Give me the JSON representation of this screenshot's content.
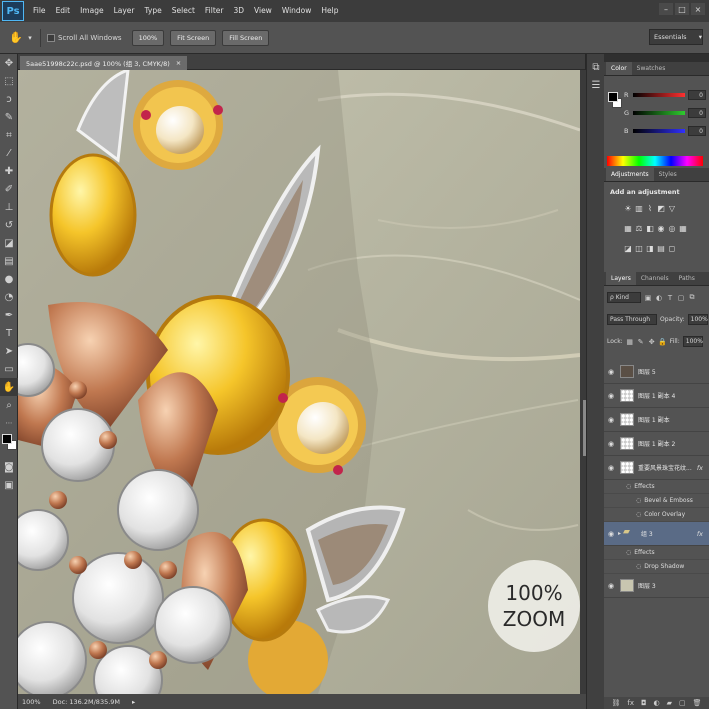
{
  "app": {
    "logo": "Ps"
  },
  "menu": [
    "File",
    "Edit",
    "Image",
    "Layer",
    "Type",
    "Select",
    "Filter",
    "3D",
    "View",
    "Window",
    "Help"
  ],
  "window_controls": [
    "–",
    "□",
    "×"
  ],
  "options_bar": {
    "scroll_all_windows": "Scroll All Windows",
    "btn_100": "100%",
    "btn_fit": "Fit Screen",
    "btn_fill": "Fill Screen",
    "workspace": "Essentials"
  },
  "document": {
    "tab_title": "5aae51998c22c.psd @ 100% (组 3, CMYK/8)",
    "zoom_badge_line1": "100%",
    "zoom_badge_line2": "ZOOM"
  },
  "status": {
    "zoom": "100%",
    "doc": "Doc: 136.2M/835.9M"
  },
  "color_panel": {
    "tabs": [
      "Color",
      "Swatches"
    ],
    "r": {
      "label": "R",
      "value": "0"
    },
    "g": {
      "label": "G",
      "value": "0"
    },
    "b": {
      "label": "B",
      "value": "0"
    },
    "colors": {
      "r": "#ff3030",
      "g": "#2ecc2e",
      "b": "#3030ff"
    }
  },
  "adjustments_panel": {
    "tabs": [
      "Adjustments",
      "Styles"
    ],
    "title": "Add an adjustment"
  },
  "layers_panel": {
    "tabs": [
      "Layers",
      "Channels",
      "Paths"
    ],
    "kind": "ρ Kind",
    "blend_mode": "Pass Through",
    "opacity_label": "Opacity:",
    "opacity_value": "100%",
    "lock_label": "Lock:",
    "fill_label": "Fill:",
    "fill_value": "100%",
    "layers": [
      {
        "name": "图层 5",
        "thumb": "dark",
        "fx": "",
        "selected": false
      },
      {
        "name": "图层 1 副本 4",
        "thumb": "checker",
        "fx": "",
        "selected": false
      },
      {
        "name": "图层 1 副本",
        "thumb": "checker",
        "fx": "",
        "selected": false
      },
      {
        "name": "图层 1 副本 2",
        "thumb": "checker",
        "fx": "",
        "selected": false
      },
      {
        "name": "重要风景珠宝花纹...",
        "thumb": "checker",
        "fx": "fx",
        "selected": false
      }
    ],
    "effects_1": {
      "label": "Effects",
      "items": [
        "Bevel & Emboss",
        "Color Overlay"
      ]
    },
    "group": {
      "name": "组 3",
      "fx": "fx"
    },
    "effects_2": {
      "label": "Effects",
      "items": [
        "Drop Shadow"
      ]
    },
    "bottom_layer": {
      "name": "图层 3"
    }
  }
}
